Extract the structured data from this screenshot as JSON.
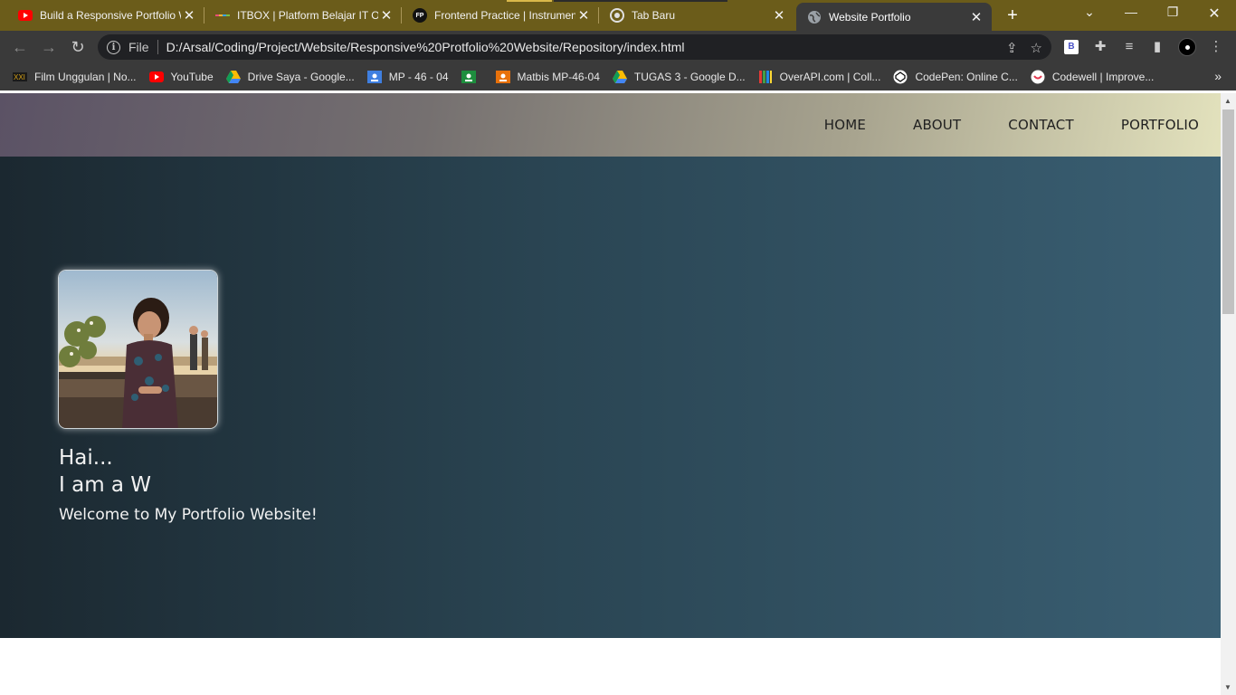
{
  "browser": {
    "tabs": [
      {
        "title": "Build a Responsive Portfolio W",
        "favicon": "youtube-icon"
      },
      {
        "title": "ITBOX | Platform Belajar IT Or",
        "favicon": "itbox-icon"
      },
      {
        "title": "Frontend Practice | Instrumen",
        "favicon": "fp-icon"
      },
      {
        "title": "Tab Baru",
        "favicon": "chrome-icon"
      },
      {
        "title": "Website Portfolio",
        "favicon": "globe-icon",
        "active": true
      }
    ],
    "fp_badge": "FP",
    "address": {
      "scheme_label": "File",
      "url": "D:/Arsal/Coding/Project/Website/Responsive%20Protfolio%20Website/Repository/index.html"
    },
    "ext_b_label": "B",
    "bookmarks": [
      {
        "label": "Film Unggulan | No...",
        "icon": "xxi-icon"
      },
      {
        "label": "YouTube",
        "icon": "youtube-icon"
      },
      {
        "label": "Drive Saya - Google...",
        "icon": "google-drive-icon"
      },
      {
        "label": "MP - 46 - 04",
        "icon": "classroom-icon"
      },
      {
        "label": "",
        "icon": "classroom-green-icon"
      },
      {
        "label": "Matbis MP-46-04",
        "icon": "classroom-orange-icon"
      },
      {
        "label": "TUGAS 3 - Google D...",
        "icon": "google-drive-icon"
      },
      {
        "label": "OverAPI.com | Coll...",
        "icon": "overapi-icon"
      },
      {
        "label": "CodePen: Online C...",
        "icon": "codepen-icon"
      },
      {
        "label": "Codewell | Improve...",
        "icon": "codewell-icon"
      }
    ]
  },
  "site": {
    "nav": [
      "HOME",
      "ABOUT",
      "CONTACT",
      "PORTFOLIO"
    ],
    "hero": {
      "greeting": "Hai...",
      "typed": "I am a W",
      "subtitle": "Welcome to My Portfolio Website!"
    }
  },
  "colors": {
    "tabstrip": "#6b5c1a",
    "toolbar": "#3a3a3a",
    "hero_start": "#1b2830",
    "hero_end": "#3a5f73"
  }
}
